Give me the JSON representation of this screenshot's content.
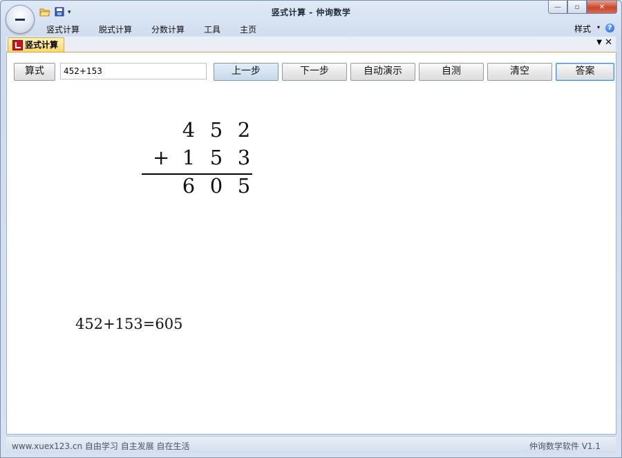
{
  "window": {
    "title": "竖式计算 - 仲询数学",
    "controls": {
      "minimize": "—",
      "restore": "▫",
      "close": "✕"
    }
  },
  "quick_access": {
    "icons": [
      "open-folder-icon",
      "save-disk-icon",
      "customize-dropdown-icon"
    ],
    "more": "▾"
  },
  "menu": {
    "items": [
      "竖式计算",
      "脱式计算",
      "分数计算",
      "工具",
      "主页"
    ],
    "style_label": "样式",
    "style_arrow": "▾",
    "help": "?"
  },
  "doc_tab": {
    "label": "竖式计算",
    "dropdown": "▼",
    "close": "✕"
  },
  "toolbar": {
    "expr_label": "算式",
    "expr_value": "452+153",
    "buttons": [
      "上一步",
      "下一步",
      "自动演示",
      "自测",
      "清空",
      "答案"
    ]
  },
  "calculation": {
    "row1": [
      "4",
      "5",
      "2"
    ],
    "operator": "+",
    "row2": [
      "1",
      "5",
      "3"
    ],
    "result": [
      "6",
      "0",
      "5"
    ],
    "equation": "452+153=605"
  },
  "status": {
    "left": "www.xuex123.cn 自由学习 自主发展 自在生活",
    "right": "仲询数学软件 V1.1"
  },
  "colors": {
    "accent": "#ffd86a",
    "close_button": "#c9462c",
    "frame": "#dce7f5"
  }
}
